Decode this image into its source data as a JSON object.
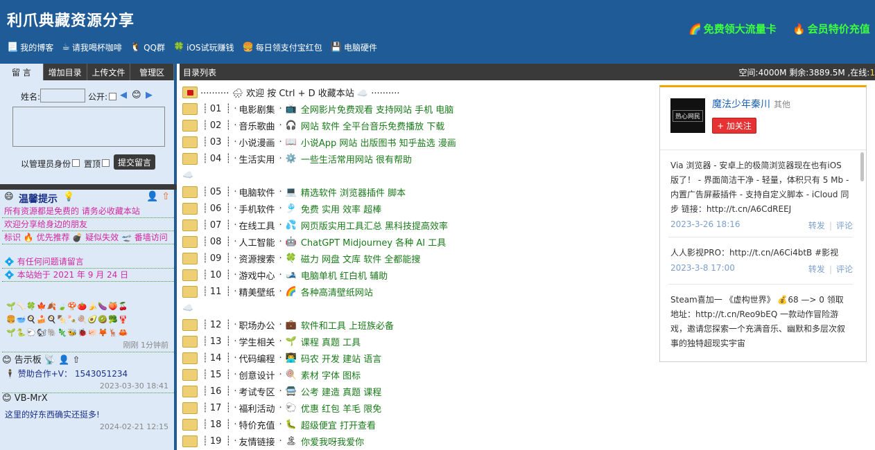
{
  "header": {
    "title": "利爪典藏资源分享",
    "promos": [
      {
        "icon": "🌈",
        "label": "免费领大流量卡"
      },
      {
        "icon": "🔥",
        "label": "会员特价充值"
      }
    ],
    "nav": [
      {
        "icon": "📃",
        "label": "我的博客"
      },
      {
        "icon": "☕",
        "label": "请我喝杯咖啡"
      },
      {
        "icon": "🐧",
        "label": "QQ群"
      },
      {
        "icon": "🍀",
        "label": "iOS试玩赚钱"
      },
      {
        "icon": "🍔",
        "label": "每日领支付宝红包"
      },
      {
        "icon": "💾",
        "label": "电脑硬件"
      }
    ]
  },
  "sidebar": {
    "tabs": [
      "留 言",
      "增加目录",
      "上传文件",
      "管理区"
    ],
    "form": {
      "name_label": "姓名:",
      "public_label": "公开:",
      "admin_label": "以管理员身份",
      "top_label": "置顶",
      "submit_label": "提交留言",
      "smile": "😊"
    },
    "notice": {
      "title": "温馨提示",
      "title_icon": "💡",
      "lines": [
        "所有资源都是免费的 请务必收藏本站",
        "欢迎分享给身边的朋友",
        "标识 🔥 优先推荐 💣 疑似失效 🛫 番墙访问",
        "💠 有任何问题请留言",
        "💠 本站始于 2021 年 9 月 24 日"
      ],
      "emoji_rows": [
        "🌱🦴🍀🍁🍂🍃🍄🍅🍌🍆🍑🍒",
        "🍔🥣🍳🍰🍳🍢🍡🍭🥑🥝🥦🦞",
        "🌱🐍🐑🐿🐘🦎🐝🐞🐖🦊🦌🦀"
      ],
      "time": "刚刚 1分钟前"
    },
    "posts": [
      {
        "icon": "😊",
        "title": "告示板",
        "title_icon": "📡",
        "body": "🕴 赞助合作+V： 1543051234",
        "time": "2023-03-30 18:41"
      },
      {
        "icon": "😊",
        "title": "VB-MrX",
        "body": "这里的好东西确实还挺多!",
        "time": "2024-02-21 12:15"
      }
    ]
  },
  "main": {
    "bar_title": "目录列表",
    "space": "空间:4000M 剩余:3889.5M ,在线:",
    "online": "1",
    "welcome": "·········· 🌧 欢迎 按 Ctrl + D 收藏本站 ☁️ ··········",
    "cloud": "☁️",
    "dirs": [
      {
        "num": "01",
        "name": "电影剧集",
        "icon": "📺",
        "desc": "全网影片免费观看 支持网站 手机 电脑"
      },
      {
        "num": "02",
        "name": "音乐歌曲",
        "icon": "🎧",
        "desc": "网站 软件 全平台音乐免费播放 下载"
      },
      {
        "num": "03",
        "name": "小说漫画",
        "icon": "📖",
        "desc": "小说App 网站 出版图书 知乎盐选 漫画"
      },
      {
        "num": "04",
        "name": "生活实用",
        "icon": "⚙️",
        "desc": "一些生活常用网站 很有帮助"
      },
      {
        "num": "05",
        "name": "电脑软件",
        "icon": "💻",
        "desc": "精选软件 浏览器插件 脚本"
      },
      {
        "num": "06",
        "name": "手机软件",
        "icon": "🎐",
        "desc": "免费 实用 效率 超棒"
      },
      {
        "num": "07",
        "name": "在线工具",
        "icon": "💦",
        "desc": "网页版实用工具汇总 黑科技提高效率"
      },
      {
        "num": "08",
        "name": "人工智能",
        "icon": "🤖",
        "desc": "ChatGPT Midjourney 各种 AI 工具"
      },
      {
        "num": "09",
        "name": "资源搜索",
        "icon": "🍀",
        "desc": "磁力 网盘 文库 软件 全都能搜"
      },
      {
        "num": "10",
        "name": "游戏中心",
        "icon": "🎿",
        "desc": "电脑单机 红白机 辅助"
      },
      {
        "num": "11",
        "name": "精美壁纸",
        "icon": "🌈",
        "desc": "各种高清壁纸网站"
      },
      {
        "num": "12",
        "name": "职场办公",
        "icon": "💼",
        "desc": "软件和工具 上班族必备"
      },
      {
        "num": "13",
        "name": "学生相关",
        "icon": "🌱",
        "desc": "课程 真题 工具"
      },
      {
        "num": "14",
        "name": "代码编程",
        "icon": "👨‍💻",
        "desc": "码农 开发 建站 语言"
      },
      {
        "num": "15",
        "name": "创意设计",
        "icon": "🍭",
        "desc": "素材 字体 图标"
      },
      {
        "num": "16",
        "name": "考试专区",
        "icon": "🚍",
        "desc": "公考 建造 真题 课程"
      },
      {
        "num": "17",
        "name": "福利活动",
        "icon": "🐑",
        "desc": "优惠 红包 羊毛 限免"
      },
      {
        "num": "18",
        "name": "特价充值",
        "icon": "🐛",
        "desc": "超级便宜 打开查看"
      },
      {
        "num": "19",
        "name": "友情链接",
        "icon": "🏝",
        "desc": "你爱我呀我爱你"
      }
    ]
  },
  "weibo": {
    "avatar_text": "热心网民",
    "name": "魔法少年秦川",
    "category": "其他",
    "follow": "+ 加关注",
    "feed": [
      {
        "text": "Via 浏览器 - 安卓上的极简浏览器现在也有iOS 版了！ - 界面简洁干净 - 轻量，体积只有 5 Mb - 内置广告屏蔽插件 - 支持自定义脚本 - iCloud 同步 链接：http://t.cn/A6CdREEJ",
        "date": "2023-3-26 18:16"
      },
      {
        "text": "人人影视PRO：http://t.cn/A6Ci4btB #影视",
        "date": "2023-3-8 17:00"
      },
      {
        "text": "Steam喜加一 《虚构世界》 💰68 —> 0 领取地址：http://t.cn/Reo9bEQ 一款动作冒险游戏，邀请您探索一个充满音乐、幽默和多层次叙事的独特超现实宇宙",
        "date": ""
      }
    ],
    "repost": "转发",
    "comment": "评论"
  }
}
